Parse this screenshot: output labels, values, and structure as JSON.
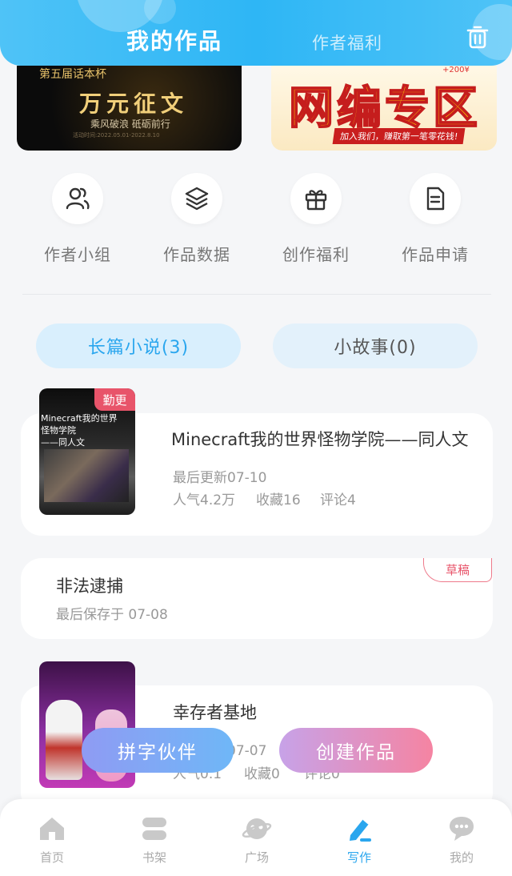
{
  "header": {
    "tabs": [
      {
        "label": "我的作品",
        "active": true
      },
      {
        "label": "作者福利",
        "active": false
      }
    ],
    "trash_icon": "trash-icon"
  },
  "banners": [
    {
      "line1": "第五届话本杯",
      "line2": "万元征文",
      "line3": "乘风破浪 砥砺前行",
      "line4": "活动时间:2022.05.01-2022.8.10"
    },
    {
      "small": "+200¥",
      "big": "网编专区",
      "ribbon": "加入我们，赚取第一笔零花钱!"
    }
  ],
  "quick_actions": [
    {
      "label": "作者小组",
      "icon": "group-icon"
    },
    {
      "label": "作品数据",
      "icon": "layers-icon"
    },
    {
      "label": "创作福利",
      "icon": "gift-icon"
    },
    {
      "label": "作品申请",
      "icon": "document-icon"
    }
  ],
  "work_tabs": [
    {
      "label": "长篇小说(3)",
      "active": true
    },
    {
      "label": "小故事(0)",
      "active": false
    }
  ],
  "works": [
    {
      "title": "Minecraft我的世界怪物学院——同人文",
      "tag": "勤更",
      "updated": "最后更新07-10",
      "popularity": "人气4.2万",
      "favorites": "收藏16",
      "comments": "评论4",
      "cover_text": "Minecraft我的世界\n怪物学院\n——同人文"
    },
    {
      "title": "非法逮捕",
      "tag": "草稿",
      "saved": "最后保存于 07-08"
    },
    {
      "title": "幸存者基地",
      "updated": "最后更新07-07",
      "popularity": "人气0.1",
      "favorites": "收藏0",
      "comments": "评论0"
    }
  ],
  "floating_buttons": {
    "partner": "拼字伙伴",
    "create": "创建作品"
  },
  "bottom_nav": [
    {
      "label": "首页",
      "icon": "home-icon",
      "active": false
    },
    {
      "label": "书架",
      "icon": "bookshelf-icon",
      "active": false
    },
    {
      "label": "广场",
      "icon": "planet-icon",
      "active": false
    },
    {
      "label": "写作",
      "icon": "pen-icon",
      "active": true
    },
    {
      "label": "我的",
      "icon": "chat-bubble-icon",
      "active": false
    }
  ],
  "colors": {
    "accent": "#2aa6ee",
    "header": "#3dbdf6",
    "tag_red": "#e8546a"
  }
}
